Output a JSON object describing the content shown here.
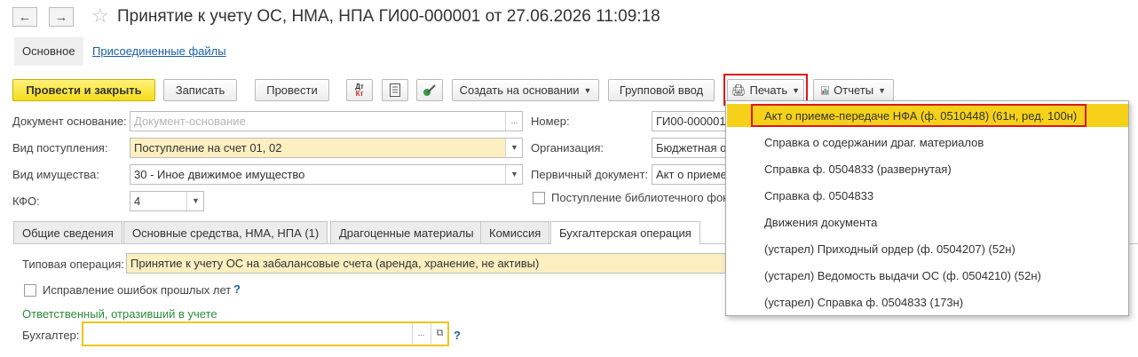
{
  "window": {
    "title": "Принятие к учету ОС, НМА, НПА ГИ00-000001 от 27.06.2026 11:09:18",
    "back_icon": "arrow-left-icon",
    "forward_icon": "arrow-right-icon",
    "favorite_icon": "star-icon"
  },
  "tabs_top": [
    "Основное",
    "Присоединенные файлы"
  ],
  "toolbar": {
    "post_close": "Провести и закрыть",
    "save": "Записать",
    "post": "Провести",
    "dtkt_icon_top": "Дт",
    "dtkt_icon_bottom": "Кт",
    "create_based": "Создать на основании",
    "group_input": "Групповой ввод",
    "print": "Печать",
    "reports": "Отчеты"
  },
  "form_left": {
    "doc_basis_label": "Документ основание:",
    "doc_basis_placeholder": "Документ-основание",
    "receipt_type_label": "Вид поступления:",
    "receipt_type_value": "Поступление на счет 01, 02",
    "property_type_label": "Вид имущества:",
    "property_type_value": "30 - Иное движимое имущество",
    "kfo_label": "КФО:",
    "kfo_value": "4"
  },
  "form_right": {
    "number_label": "Номер:",
    "number_value": "ГИ00-000001",
    "org_label": "Организация:",
    "org_value": "Бюджетная о",
    "primary_doc_label": "Первичный документ:",
    "primary_doc_value": "Акт о приеме",
    "library_label": "Поступление библиотечного фонд"
  },
  "doc_tabs": [
    "Общие сведения",
    "Основные средства, НМА, НПА (1)",
    "Драгоценные материалы",
    "Комиссия",
    "Бухгалтерская операция"
  ],
  "operation": {
    "typical_label": "Типовая операция:",
    "typical_value": "Принятие к учету ОС на забалансовые счета (аренда, хранение, не активы)",
    "fix_errors_label": "Исправление ошибок прошлых лет",
    "help_mark": "?",
    "responsible_header": "Ответственный, отразивший в учете",
    "accountant_label": "Бухгалтер:"
  },
  "print_menu": {
    "items": [
      "Акт о приеме-передаче НФА (ф. 0510448) (61н, ред. 100н)",
      "Справка о содержании драг. материалов",
      "Справка ф. 0504833 (развернутая)",
      "Справка ф. 0504833",
      "Движения документа",
      "(устарел) Приходный ордер (ф. 0504207) (52н)",
      "(устарел) Ведомость выдачи ОС (ф. 0504210) (52н)",
      "(устарел) Справка ф. 0504833 (173н)"
    ]
  },
  "colors": {
    "primary_button": "#f5dc1b",
    "highlight": "#f5d11a",
    "annotation_red": "#e1151d",
    "field_yellow": "#fcefc0",
    "link_blue": "#1a5faa",
    "section_green": "#2e8b3a"
  }
}
